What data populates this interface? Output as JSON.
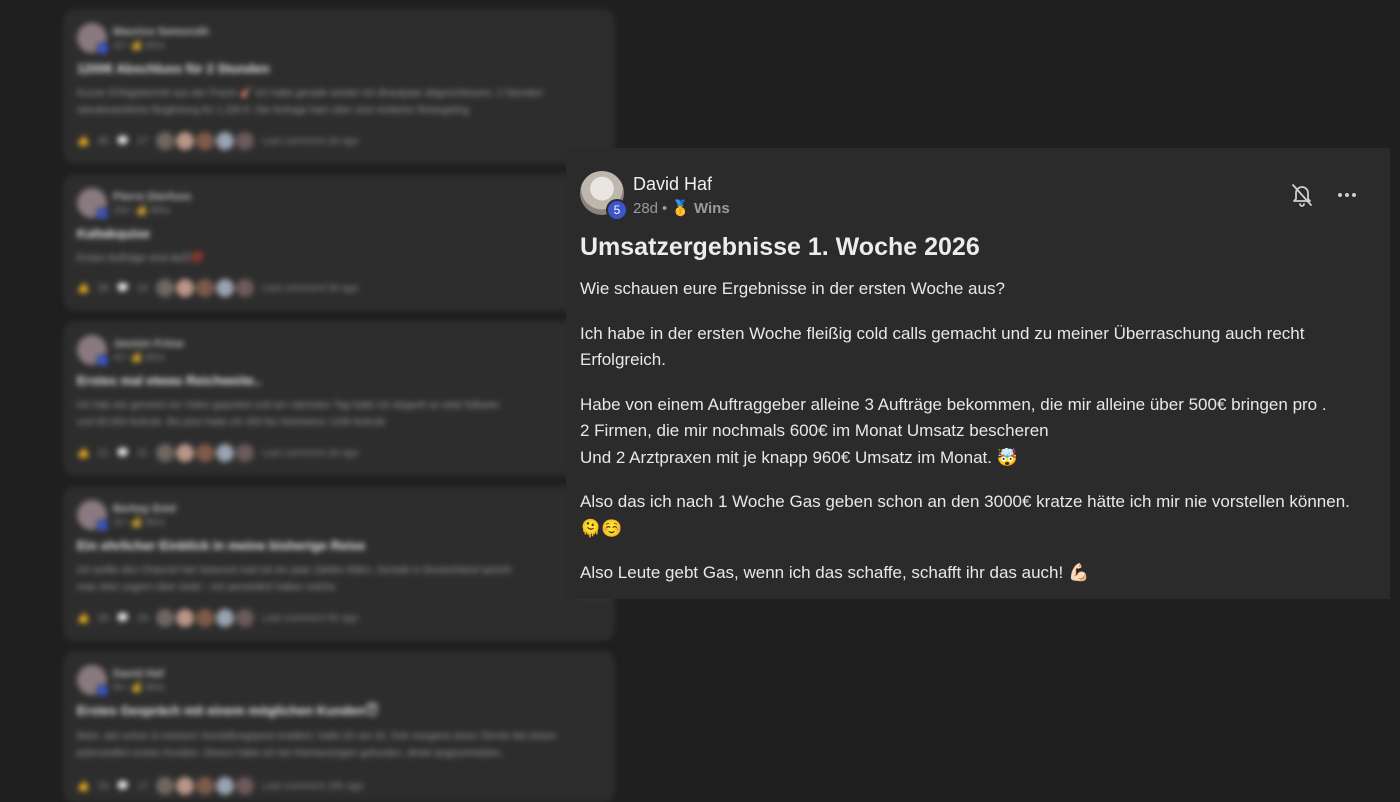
{
  "feed": [
    {
      "author": "Maurice Semoroth",
      "meta": "2d • 💰 Wins",
      "title": "1200€ Abschluss für 2 Stunden",
      "body": "Kurzer Erfolgsbericht aus der Praxis 🎸 Ich habe gerade wieder ein Brautpaar abgeschlossen. 2 Stunden standesamtliche Begleitung für 1.200 €. Die Anfrage kam über eine einfache Retargeting",
      "likes": "35",
      "comments": "27",
      "last": "Last comment 2d ago"
    },
    {
      "author": "Pierre Dierfuss",
      "meta": "16d • 💰 Wins",
      "title": "Kaltakquise",
      "body": "Ersten Aufträge sind da😊💯",
      "likes": "28",
      "comments": "24",
      "last": "Last comment 5d ago"
    },
    {
      "author": "Jasmin Fröse",
      "meta": "4d • 💰 Wins",
      "title": "Erstes mal etwas Reichweite..",
      "body": "Ich hab wie gemeint ein Video gepostet und am nächsten Tag hatte ich doppelt so viele follower und 60.000 Aufrufe. Bis jetzt hatte ich 200 bis höchstens 1200 Aufrufe",
      "likes": "21",
      "comments": "31",
      "last": "Last comment 2d ago"
    },
    {
      "author": "Berkay Emir",
      "meta": "2d • 💰 Wins",
      "title": "Ein ehrlicher Einblick in meine bisherige Reise",
      "body": "Ich wollte den Channel hier bewusst mal mit ein paar Zahlen füllen. Gerade in Deutschland spricht man eher ungern über Geld – mir persönlich haben solche",
      "likes": "18",
      "comments": "28",
      "last": "Last comment 6h ago"
    },
    {
      "author": "David Haf",
      "meta": "8d • 💰 Wins",
      "title": "Erstes Gespräch mit einem möglichen Kunden😇",
      "body": "Moin, wie schon in meinem Vorstellungspost erwähnt, hatte ich am 31. früh morgens einen Termin bei einem potenziellen ersten Kunden. Diesen habe ich bei Kleinanzeigen gefunden, direkt angeschrieben,",
      "likes": "19",
      "comments": "17",
      "last": "Last comment 18h ago"
    }
  ],
  "post": {
    "author": "David Haf",
    "level": "5",
    "age": "28d",
    "separator": "•",
    "category_icon": "🥇",
    "category": "Wins",
    "title": "Umsatzergebnisse 1. Woche 2026",
    "paragraphs": [
      "Wie schauen eure Ergebnisse in der ersten Woche aus?",
      "Ich habe in der ersten Woche fleißig cold calls gemacht und zu meiner Überraschung auch recht Erfolgreich.",
      "Habe von einem Auftraggeber alleine 3 Aufträge bekommen, die mir alleine über 500€ bringen pro .\n2 Firmen, die mir nochmals 600€ im Monat Umsatz bescheren\nUnd 2 Arztpraxen mit je knapp 960€ Umsatz im Monat. 🤯",
      "Also das ich nach 1 Woche Gas geben schon an den 3000€ kratze hätte ich mir nie vorstellen können.🫠☺️",
      "Also Leute gebt Gas, wenn ich das schaffe, schafft ihr das auch! 💪🏻"
    ],
    "icons": {
      "bell": "bell-off-icon",
      "more": "more-horizontal-icon"
    }
  },
  "colors": {
    "background": "#1f1f1f",
    "card": "#2d2d2d",
    "post": "#2b2b2b",
    "level_badge": "#3b56c8"
  }
}
